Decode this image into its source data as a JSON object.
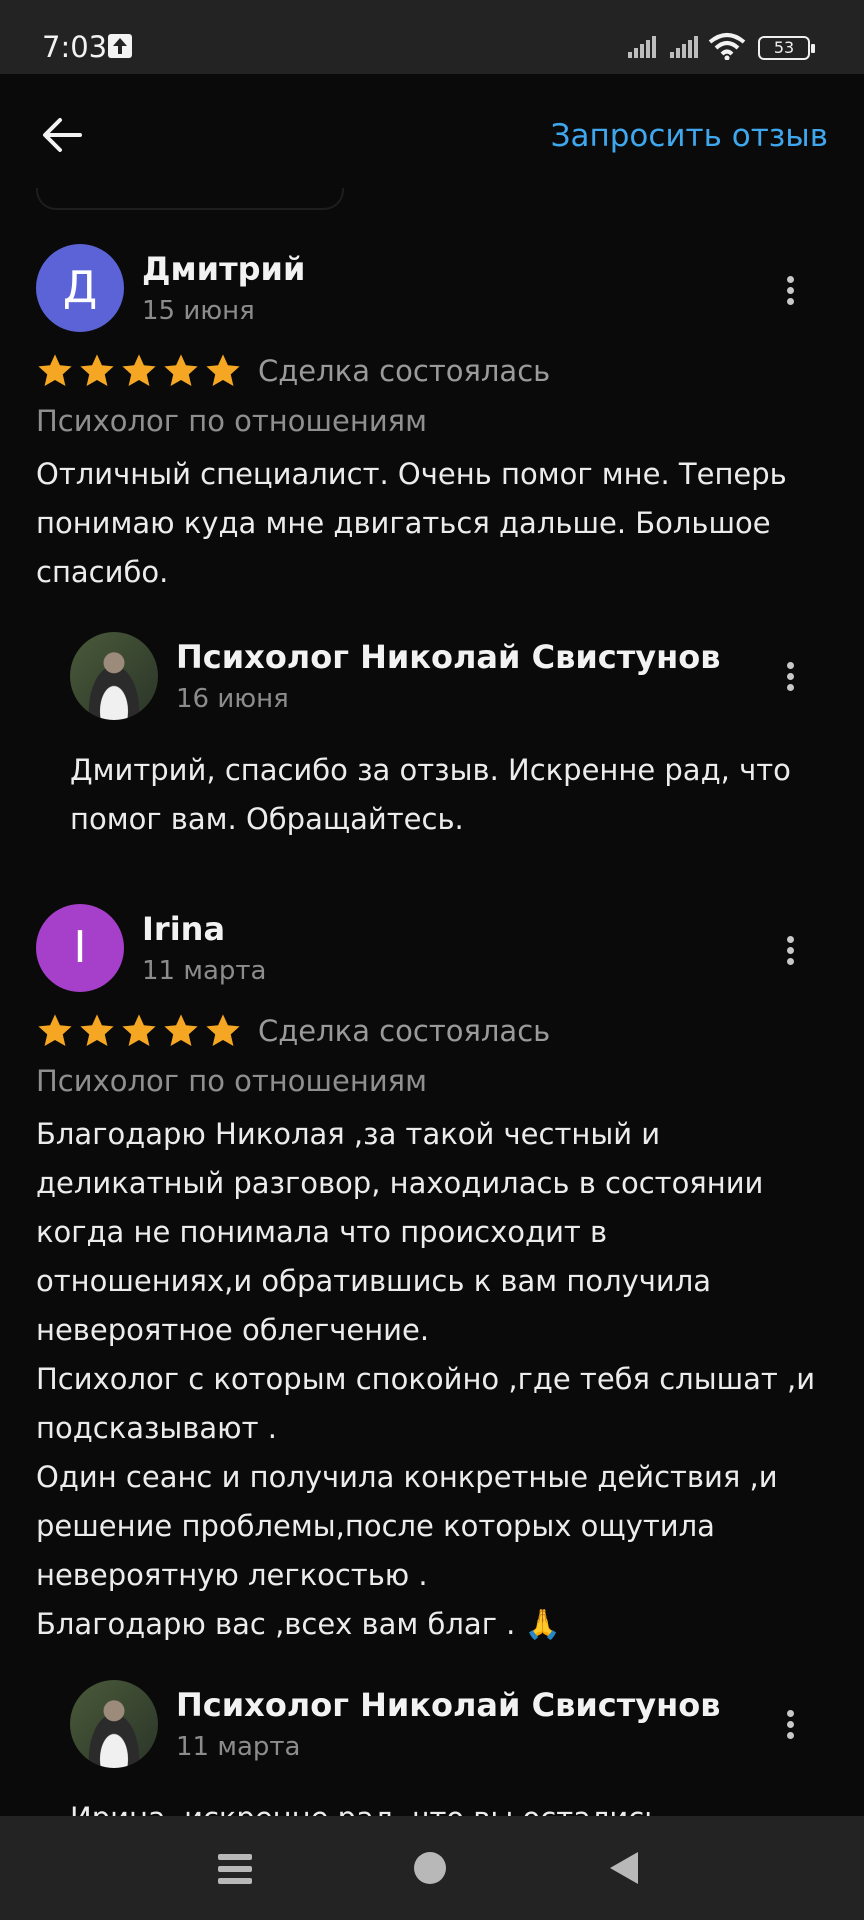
{
  "status_bar": {
    "time": "7:03",
    "battery": "53"
  },
  "header": {
    "back_icon": "arrow-left-icon",
    "request_review": "Запросить отзыв"
  },
  "reviews": [
    {
      "author": "Дмитрий",
      "avatar_letter": "Д",
      "avatar_color": "#5b63d6",
      "date": "15 июня",
      "rating": 5,
      "status": "Сделка состоялась",
      "category": "Психолог по отношениям",
      "text": "Отличный специалист. Очень помог мне. Теперь\nпонимаю куда мне двигаться дальше. Большое\nспасибо.",
      "reply": {
        "author": "Психолог Николай Свистунов",
        "date": "16 июня",
        "text": "Дмитрий, спасибо за отзыв. Искренне рад, что\nпомог вам. Обращайтесь."
      }
    },
    {
      "author": "Irina",
      "avatar_letter": "I",
      "avatar_color": "#a63fc9",
      "date": "11 марта",
      "rating": 5,
      "status": "Сделка состоялась",
      "category": "Психолог по отношениям",
      "text": "Благодарю Николая ,за такой честный и\nделикатный разговор, находилась в состоянии\nкогда не понимала что происходит в\nотношениях,и обратившись к вам получила\nневероятное облегчение.\nПсихолог с которым спокойно ,где тебя слышат ,и\nподсказывают .\nОдин сеанс и получила конкретные действия ,и\nрешение проблемы,после которых ощутила\nневероятную легкостью .\nБлагодарю вас ,всех вам благ . 🙏",
      "reply": {
        "author": "Психолог Николай Свистунов",
        "date": "11 марта",
        "text": "Ирина, искренне рад, что вы остались"
      }
    }
  ],
  "colors": {
    "accent": "#3fa7ee",
    "star": "#f5a623",
    "background": "#0a0a0a"
  }
}
